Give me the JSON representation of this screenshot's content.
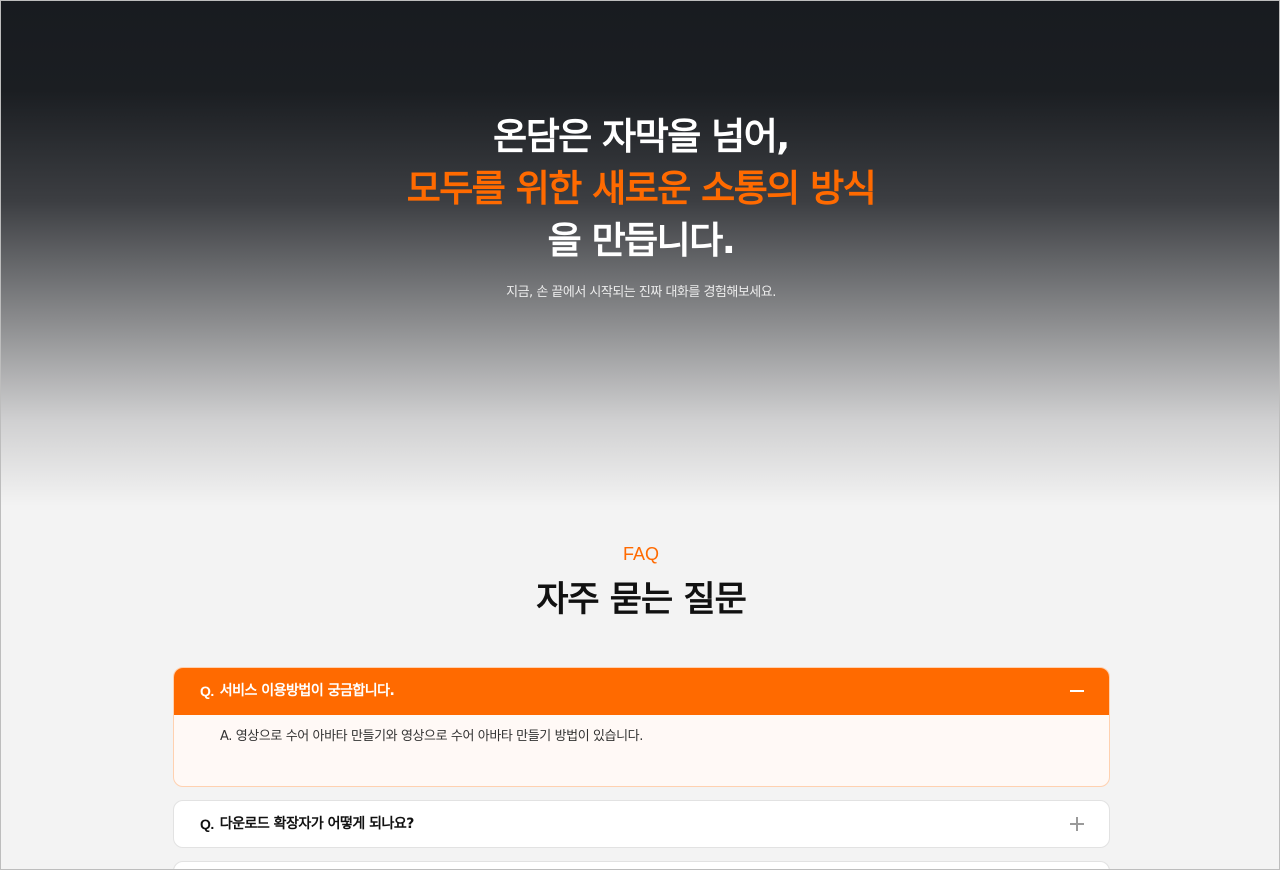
{
  "hero": {
    "line1": "온담은 자막을 넘어,",
    "line2_highlight": "모두를 위한 새로운 소통의 방식",
    "line3": "을 만듭니다.",
    "subtitle": "지금, 손 끝에서 시작되는 진짜 대화를 경험해보세요."
  },
  "faq": {
    "eyebrow": "FAQ",
    "title": "자주 묻는 질문",
    "items": [
      {
        "prefix": "Q.",
        "question": "서비스 이용방법이 궁금합니다.",
        "answer": "A. 영상으로 수어 아바타 만들기와 영상으로 수어 아바타 만들기 방법이 있습니다.",
        "expanded": true
      },
      {
        "prefix": "Q.",
        "question": "다운로드 확장자가 어떻게 되나요?",
        "expanded": false
      }
    ]
  },
  "colors": {
    "accent": "#ff6a00",
    "hero_dark": "#181b20",
    "background": "#f3f3f3"
  },
  "icons": {
    "expanded": "minus-icon",
    "collapsed": "plus-icon"
  }
}
